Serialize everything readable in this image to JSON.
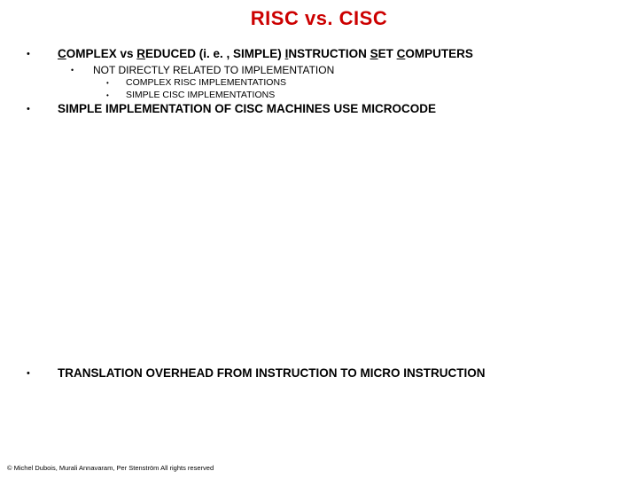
{
  "title": "RISC vs. CISC",
  "line1": {
    "c": "C",
    "omplex_vs": "OMPLEX vs ",
    "r": "R",
    "educed": "EDUCED (i. e. , SIMPLE) ",
    "i": "I",
    "nstruction": "NSTRUCTION ",
    "s": "S",
    "et": "ET ",
    "c2": "C",
    "omputers": "OMPUTERS"
  },
  "line2": "NOT DIRECTLY RELATED TO IMPLEMENTATION",
  "line3a": "COMPLEX RISC IMPLEMENTATIONS",
  "line3b": "SIMPLE CISC IMPLEMENTATIONS",
  "line4": "SIMPLE IMPLEMENTATION OF CISC MACHINES USE MICROCODE",
  "line5": "TRANSLATION OVERHEAD FROM INSTRUCTION TO MICRO INSTRUCTION",
  "footer": "© Michel Dubois, Murali Annavaram, Per Stenström All rights reserved"
}
